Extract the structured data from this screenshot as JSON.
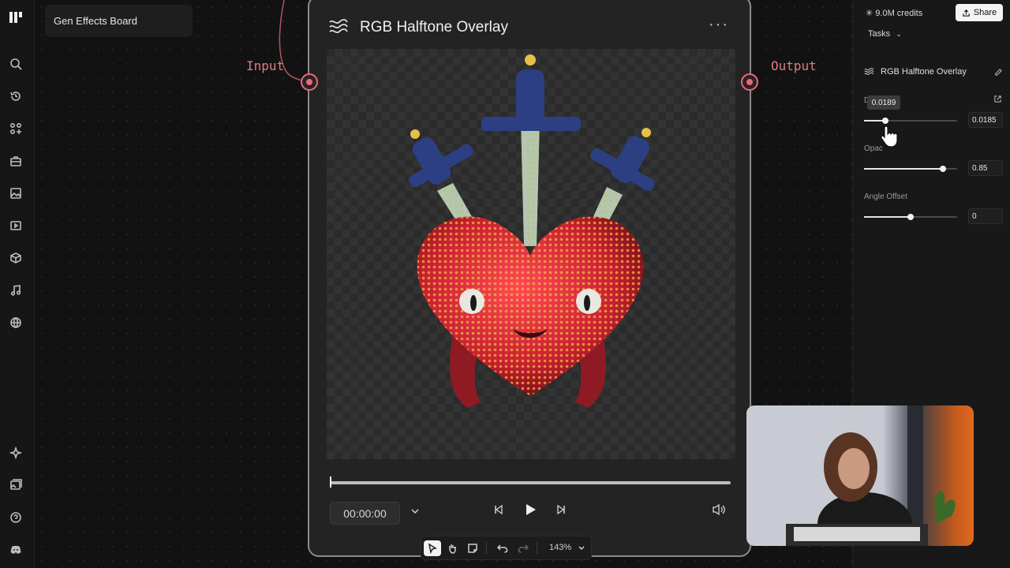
{
  "app": {
    "board_name": "Gen Effects Board"
  },
  "left_rail": {
    "icons": [
      "logo-icon",
      "search-icon",
      "history-icon",
      "apps-icon",
      "briefcase-icon",
      "image-icon",
      "video-icon",
      "cube-icon",
      "music-icon",
      "globe-icon",
      "sparkle-icon",
      "gallery-icon",
      "help-icon",
      "discord-icon"
    ]
  },
  "node": {
    "title": "RGB Halftone Overlay",
    "input_label": "Input",
    "output_label": "Output",
    "more_label": "···",
    "timecode": "00:00:00",
    "playback_progress": 0
  },
  "toolbar": {
    "zoom": "143%"
  },
  "right_panel": {
    "credits": "9.0M credits",
    "share_label": "Share",
    "tasks_label": "Tasks",
    "effect_name": "RGB Halftone Overlay",
    "tooltip_value": "0.0189",
    "params": [
      {
        "label": "D",
        "value": "0.0185",
        "fraction": 0.23
      },
      {
        "label": "Opac",
        "value": "0.85",
        "fraction": 0.85
      },
      {
        "label": "Angle Offset",
        "value": "0",
        "fraction": 0.5
      }
    ]
  },
  "colors": {
    "accent_port": "#e36b7a",
    "port_label": "#e27a86",
    "heart_red": "#d8303e"
  }
}
